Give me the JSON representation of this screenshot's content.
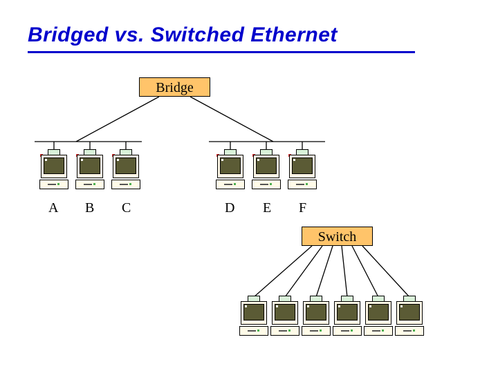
{
  "title": "Bridged vs. Switched Ethernet",
  "devices": {
    "bridge": {
      "label": "Bridge"
    },
    "switch": {
      "label": "Switch"
    }
  },
  "bridge_hosts": [
    "A",
    "B",
    "C",
    "D",
    "E",
    "F"
  ],
  "chart_data": {
    "type": "diagram",
    "title": "Bridged vs. Switched Ethernet",
    "nodes": [
      {
        "id": "Bridge",
        "kind": "bridge"
      },
      {
        "id": "A",
        "kind": "host"
      },
      {
        "id": "B",
        "kind": "host"
      },
      {
        "id": "C",
        "kind": "host"
      },
      {
        "id": "D",
        "kind": "host"
      },
      {
        "id": "E",
        "kind": "host"
      },
      {
        "id": "F",
        "kind": "host"
      },
      {
        "id": "Switch",
        "kind": "switch"
      },
      {
        "id": "S1",
        "kind": "host"
      },
      {
        "id": "S2",
        "kind": "host"
      },
      {
        "id": "S3",
        "kind": "host"
      },
      {
        "id": "S4",
        "kind": "host"
      },
      {
        "id": "S5",
        "kind": "host"
      },
      {
        "id": "S6",
        "kind": "host"
      }
    ],
    "edges": [
      {
        "from": "Bridge",
        "to": "A",
        "via": "bus-left"
      },
      {
        "from": "Bridge",
        "to": "B",
        "via": "bus-left"
      },
      {
        "from": "Bridge",
        "to": "C",
        "via": "bus-left"
      },
      {
        "from": "Bridge",
        "to": "D",
        "via": "bus-right"
      },
      {
        "from": "Bridge",
        "to": "E",
        "via": "bus-right"
      },
      {
        "from": "Bridge",
        "to": "F",
        "via": "bus-right"
      },
      {
        "from": "Switch",
        "to": "S1"
      },
      {
        "from": "Switch",
        "to": "S2"
      },
      {
        "from": "Switch",
        "to": "S3"
      },
      {
        "from": "Switch",
        "to": "S4"
      },
      {
        "from": "Switch",
        "to": "S5"
      },
      {
        "from": "Switch",
        "to": "S6"
      }
    ],
    "segments": [
      {
        "id": "bus-left",
        "hosts": [
          "A",
          "B",
          "C"
        ]
      },
      {
        "id": "bus-right",
        "hosts": [
          "D",
          "E",
          "F"
        ]
      }
    ]
  }
}
